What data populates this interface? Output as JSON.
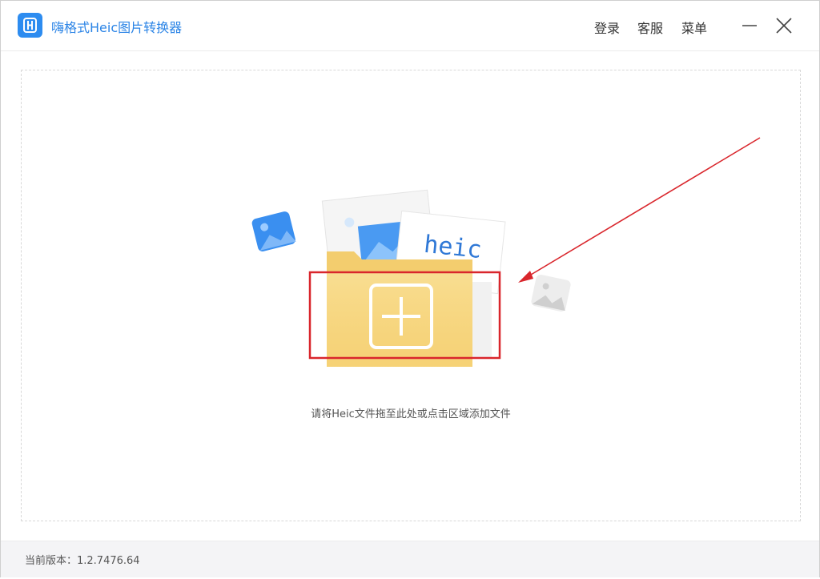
{
  "app": {
    "title": "嗨格式Heic图片转换器",
    "icon": "app-logo-icon",
    "accent": "#2d8cf0"
  },
  "header": {
    "menu": [
      {
        "label": "登录"
      },
      {
        "label": "客服"
      },
      {
        "label": "菜单"
      }
    ],
    "minimize_icon": "minimize-icon",
    "close_icon": "close-icon"
  },
  "dropzone": {
    "illustration_text": "heic",
    "hint": "请将Heic文件拖至此处或点击区域添加文件",
    "add_icon": "plus-icon",
    "annotation_color": "#d9262c"
  },
  "footer": {
    "version": "当前版本：1.2.7476.64"
  }
}
